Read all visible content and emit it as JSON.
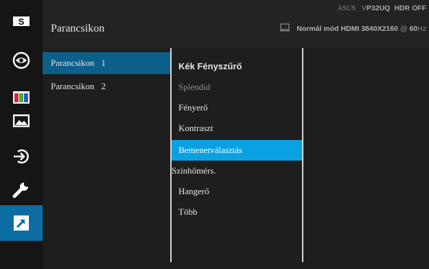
{
  "header": {
    "title": "Parancsikon",
    "brand": "ASUS",
    "model_prefix": "V",
    "model": "P32UQ",
    "hdr": "HDR OFF",
    "mode": "Normál mód",
    "input": "HDMI",
    "resolution": "3840X2160",
    "at": "@",
    "refresh": "60",
    "hz": "Hz"
  },
  "rail": {
    "icons": [
      "splendid-icon",
      "blue-light-eye-icon",
      "color-bars-icon",
      "image-icon",
      "input-select-icon",
      "system-setup-wrench-icon",
      "shortcut-arrow-icon"
    ],
    "s_glyph": "S"
  },
  "shortcuts": {
    "items": [
      {
        "label": "Parancsikon",
        "num": "1"
      },
      {
        "label": "Parancsikon",
        "num": "2"
      }
    ]
  },
  "options": {
    "items": [
      "Kék Fényszűrő",
      "Splendid",
      "Fényerő",
      "Kontraszt",
      "Bemenetválasztás",
      "Színhőmérs.",
      "Hangerő",
      "Több"
    ]
  },
  "colors": {
    "accent_active": "#0aa1e3",
    "selected_row": "#0b5f8a",
    "background": "#1e1e1e"
  }
}
